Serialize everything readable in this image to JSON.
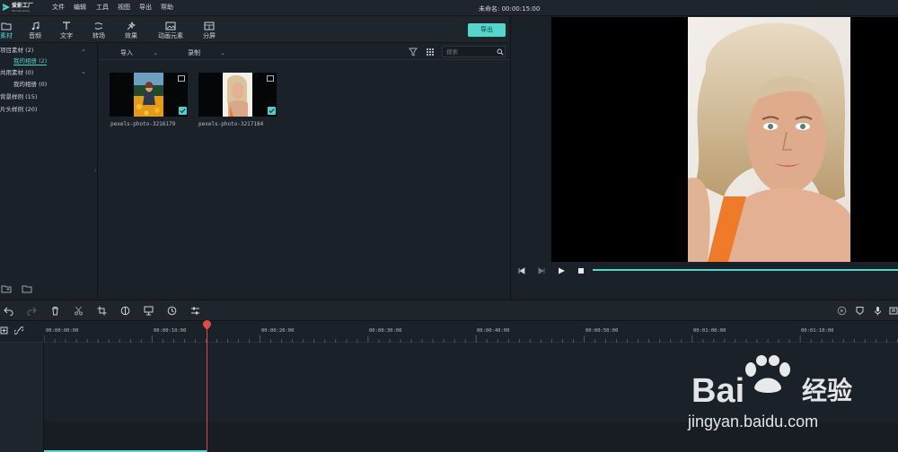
{
  "app": {
    "logo_text": "爱影工厂",
    "logo_sub": "Wondershare",
    "project_title": "未命名: 00:00:15:00"
  },
  "menu": [
    "文件",
    "编辑",
    "工具",
    "视图",
    "导出",
    "帮助"
  ],
  "toolbar": {
    "items": [
      {
        "label": "素材",
        "icon": "folder-icon"
      },
      {
        "label": "音频",
        "icon": "music-note-icon"
      },
      {
        "label": "文字",
        "icon": "text-icon"
      },
      {
        "label": "转场",
        "icon": "transition-icon"
      },
      {
        "label": "效果",
        "icon": "effects-icon"
      },
      {
        "label": "动画元素",
        "icon": "image-element-icon"
      },
      {
        "label": "分屏",
        "icon": "split-screen-icon"
      }
    ],
    "export_label": "导出"
  },
  "library": {
    "tree": [
      {
        "label": "项目素材 (2)",
        "expanded": true
      },
      {
        "label": "我的相册 (2)",
        "selected": true
      },
      {
        "label": "共用素材 (0)",
        "expanded": true
      },
      {
        "label": "我的相册 (0)"
      },
      {
        "label": "背景样例 (15)"
      },
      {
        "label": "片头样例 (20)"
      }
    ]
  },
  "media": {
    "import_label": "导入",
    "record_label": "录制",
    "search_placeholder": "搜索",
    "items": [
      {
        "name": "pexels-photo-3216179"
      },
      {
        "name": "pexels-photo-3217184"
      }
    ]
  },
  "timeline": {
    "ticks": [
      "00:00:00:00",
      "00:00:10:00",
      "00:00:20:00",
      "00:00:30:00",
      "00:00:40:00",
      "00:00:50:00",
      "00:01:00:00",
      "00:01:10:00"
    ]
  },
  "watermark": {
    "brand": "Bai",
    "brand_cn": "经验",
    "url": "jingyan.baidu.com"
  },
  "colors": {
    "accent": "#55d6cb",
    "playhead": "#e04a4a",
    "bg": "#1b2129"
  }
}
